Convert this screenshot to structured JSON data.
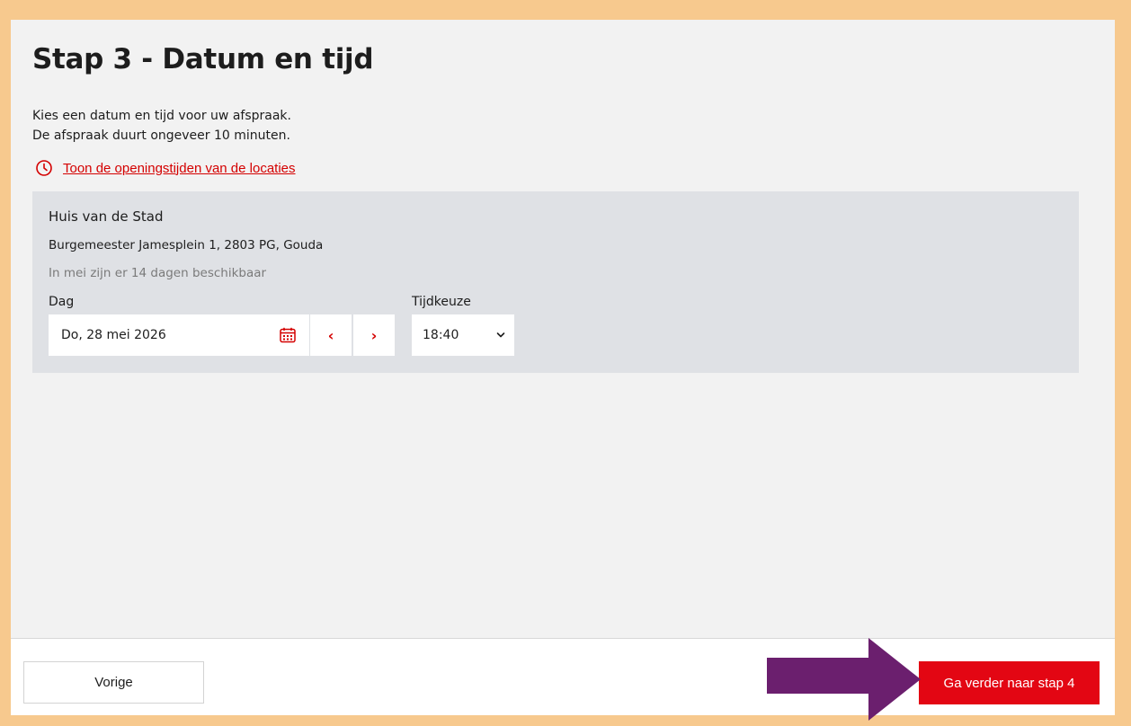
{
  "page": {
    "title": "Stap 3 - Datum en tijd",
    "intro_line1": "Kies een datum en tijd voor uw afspraak.",
    "intro_line2": "De afspraak duurt ongeveer 10 minuten.",
    "hours_link": "Toon de openingstijden van de locaties"
  },
  "location": {
    "name": "Huis van de Stad",
    "address": "Burgemeester Jamesplein 1, 2803 PG, Gouda",
    "availability": "In mei zijn er 14 dagen beschikbaar",
    "day_label": "Dag",
    "date_value": "Do, 28 mei 2026",
    "prev_glyph": "‹",
    "next_glyph": "›",
    "time_label": "Tijdkeuze",
    "time_value": "18:40"
  },
  "footer": {
    "prev_label": "Vorige",
    "next_label": "Ga verder naar stap 4"
  },
  "colors": {
    "accent": "#e30613",
    "page_border": "#f7c98e",
    "card_bg": "#dfe1e5",
    "annotation_arrow": "#6b1f6e"
  },
  "icons": [
    "clock-icon",
    "calendar-icon",
    "chevron-left-icon",
    "chevron-right-icon",
    "chevron-down-icon",
    "annotation-arrow"
  ]
}
